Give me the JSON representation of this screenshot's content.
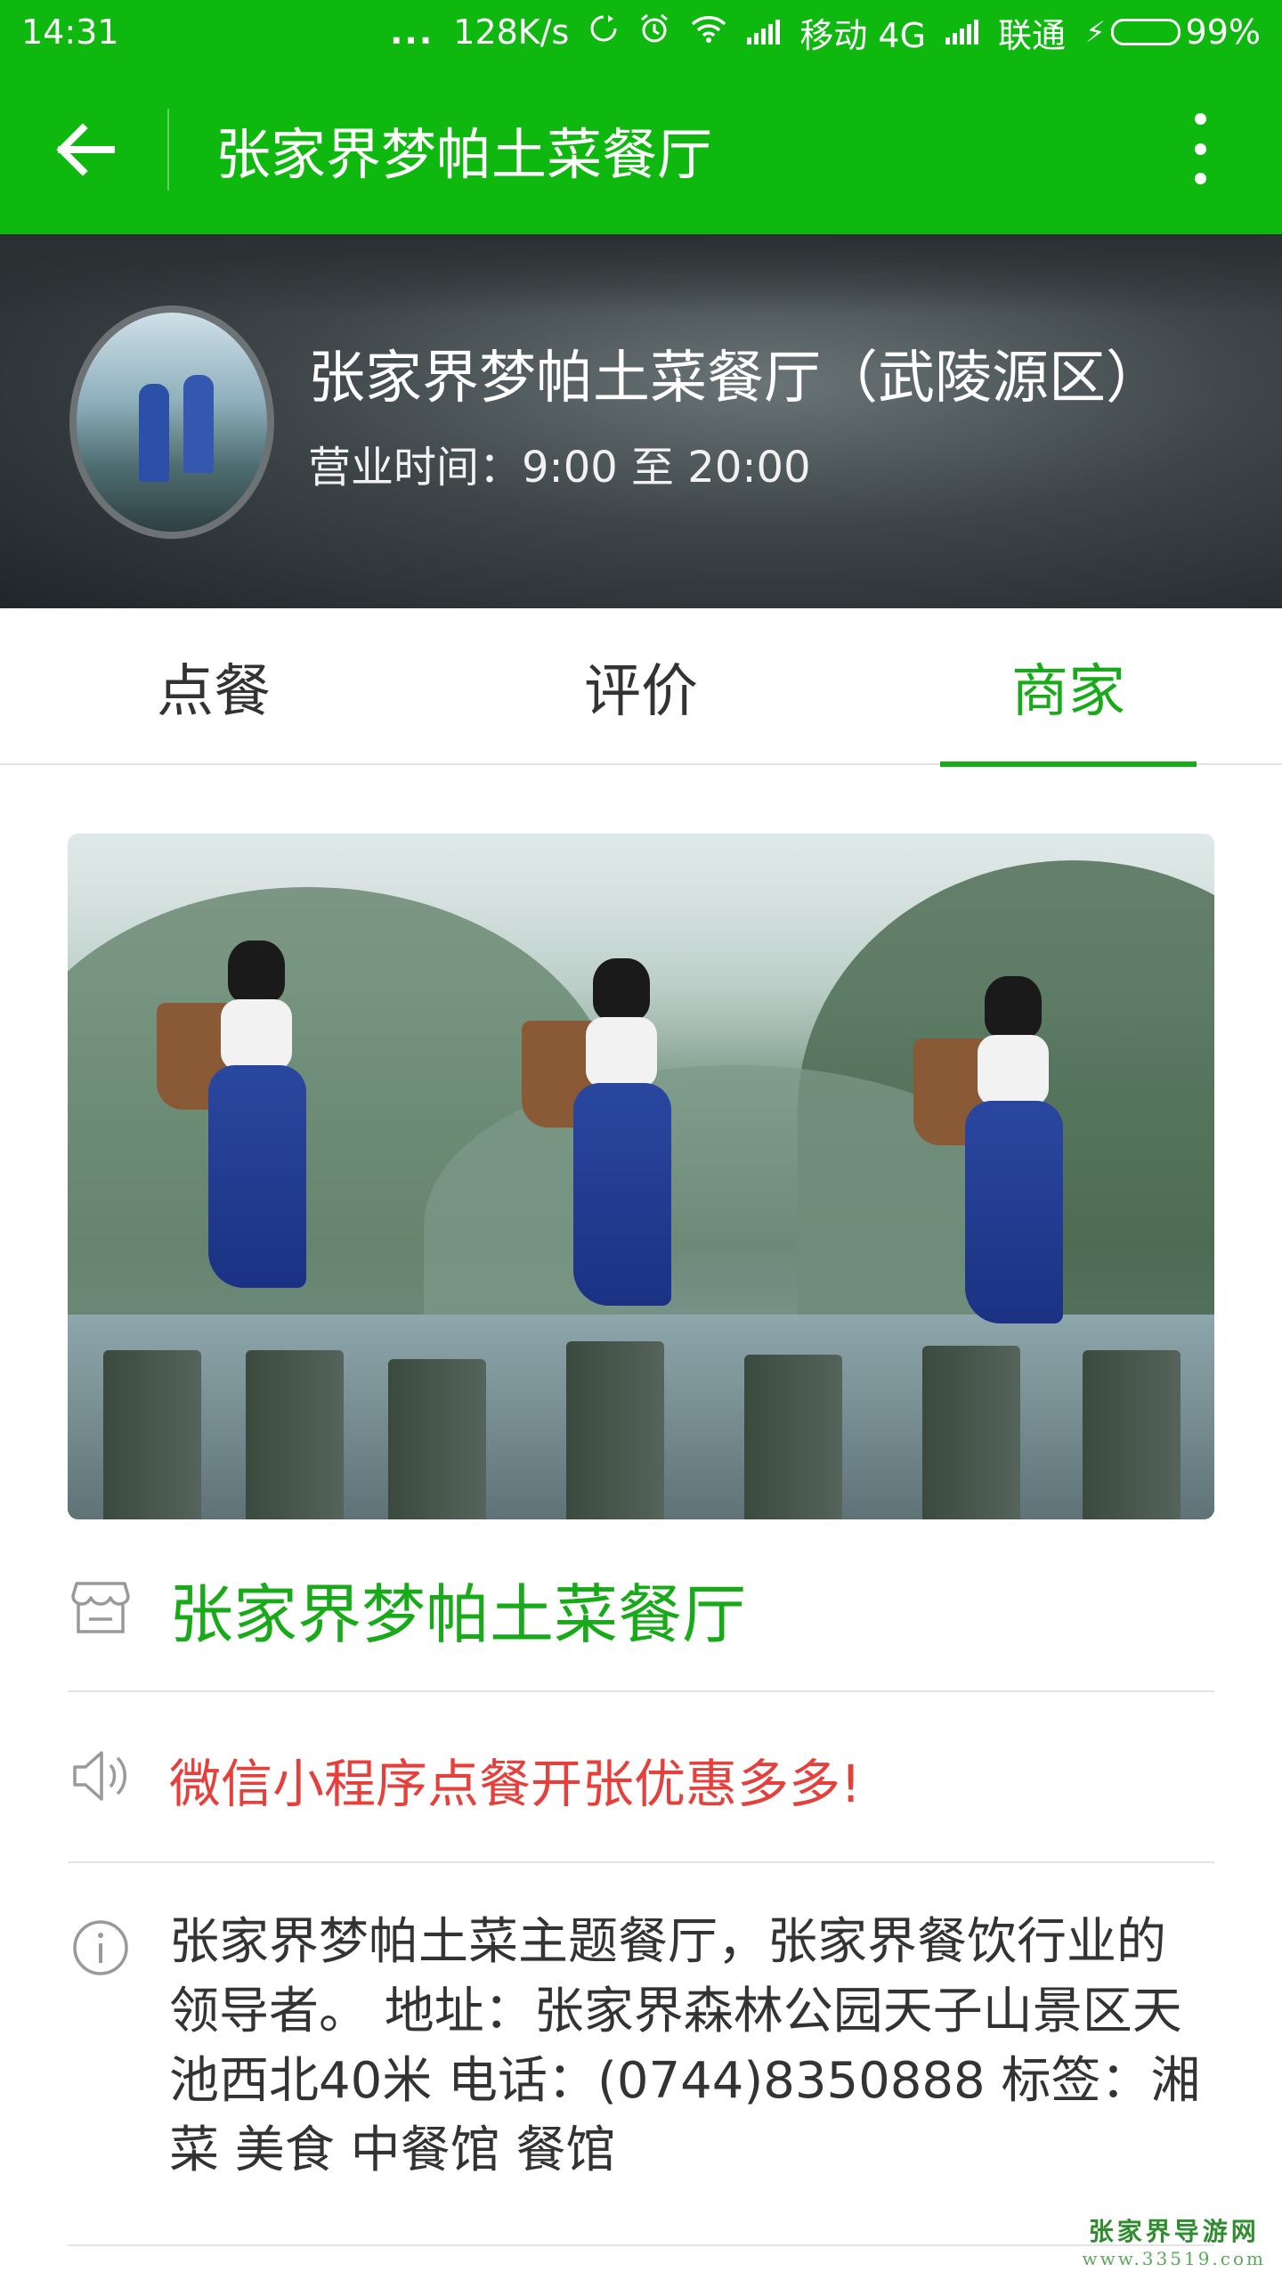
{
  "status_bar": {
    "time": "14:31",
    "dots": "...",
    "speed": "128K/s",
    "carrier1": "移动 4G",
    "carrier2": "联通",
    "battery": "99%",
    "icons": [
      "sync-icon",
      "alarm-icon",
      "wifi-icon",
      "signal-icon",
      "signal-icon",
      "charging-icon",
      "battery-icon"
    ]
  },
  "app_bar": {
    "title": "张家界梦帕土菜餐厅",
    "back_icon": "arrow-left-icon",
    "more_icon": "more-vertical-icon",
    "color": "#0fb80f"
  },
  "hero": {
    "shop_name": "张家界梦帕土菜餐厅（武陵源区）",
    "hours": "营业时间：9:00 至 20:00"
  },
  "tabs": [
    {
      "label": "点餐",
      "active": false
    },
    {
      "label": "评价",
      "active": false
    },
    {
      "label": "商家",
      "active": true
    }
  ],
  "accent_color": "#18aa18",
  "info": {
    "name": "张家界梦帕土菜餐厅",
    "name_icon": "store-icon",
    "notice": "微信小程序点餐开张优惠多多!",
    "notice_icon": "speaker-icon",
    "notice_color": "#e5403b",
    "description": "张家界梦帕土菜主题餐厅，张家界餐饮行业的领导者。 地址：张家界森林公园天子山景区天池西北40米 电话：(0744)8350888 标签：湘菜 美食 中餐馆 餐馆",
    "description_icon": "info-icon"
  },
  "watermark": {
    "line1": "张家界导游网",
    "line2": "www.33519.com"
  }
}
